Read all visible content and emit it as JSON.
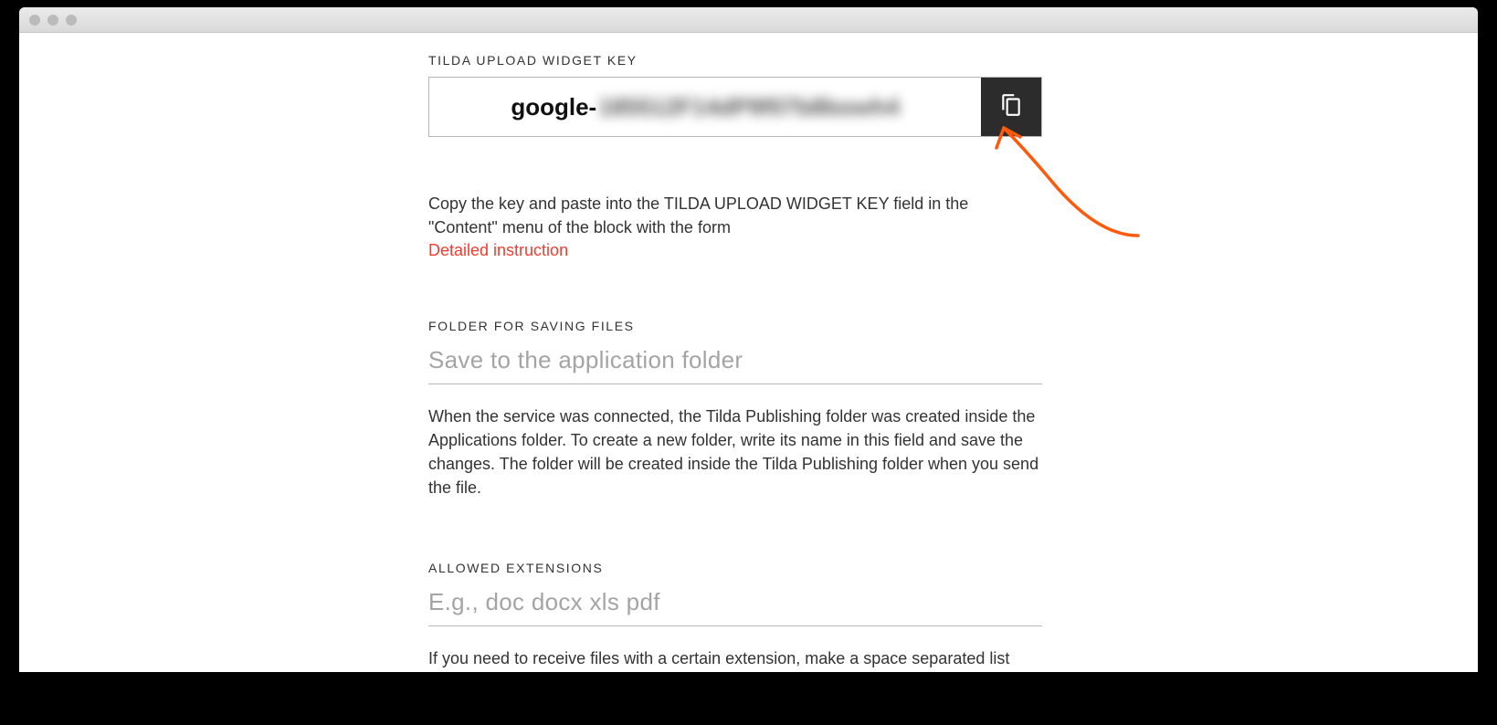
{
  "sections": {
    "widget_key": {
      "label": "TILDA UPLOAD WIDGET KEY",
      "value_visible_prefix": "google-",
      "value_blurred_part": "185512F14dP9f07b8bowh4",
      "description": "Copy the key and paste into the TILDA UPLOAD WIDGET KEY field in the \"Content\" menu of the block with the form",
      "link_text": "Detailed instruction"
    },
    "folder": {
      "label": "FOLDER FOR SAVING FILES",
      "placeholder": "Save to the application folder",
      "value": "",
      "description": "When the service was connected, the Tilda Publishing folder was created inside the Applications folder. To create a new folder, write its name in this field and save the changes. The folder will be created inside the Tilda Publishing folder when you send the file."
    },
    "extensions": {
      "label": "ALLOWED EXTENSIONS",
      "placeholder": "E.g., doc docx xls pdf",
      "value": "",
      "description": "If you need to receive files with a certain extension, make a space separated list here."
    }
  },
  "colors": {
    "accent_link": "#f03d2f",
    "copy_button_bg": "#2c2c2c",
    "annotation_arrow": "#ff5a0c"
  }
}
